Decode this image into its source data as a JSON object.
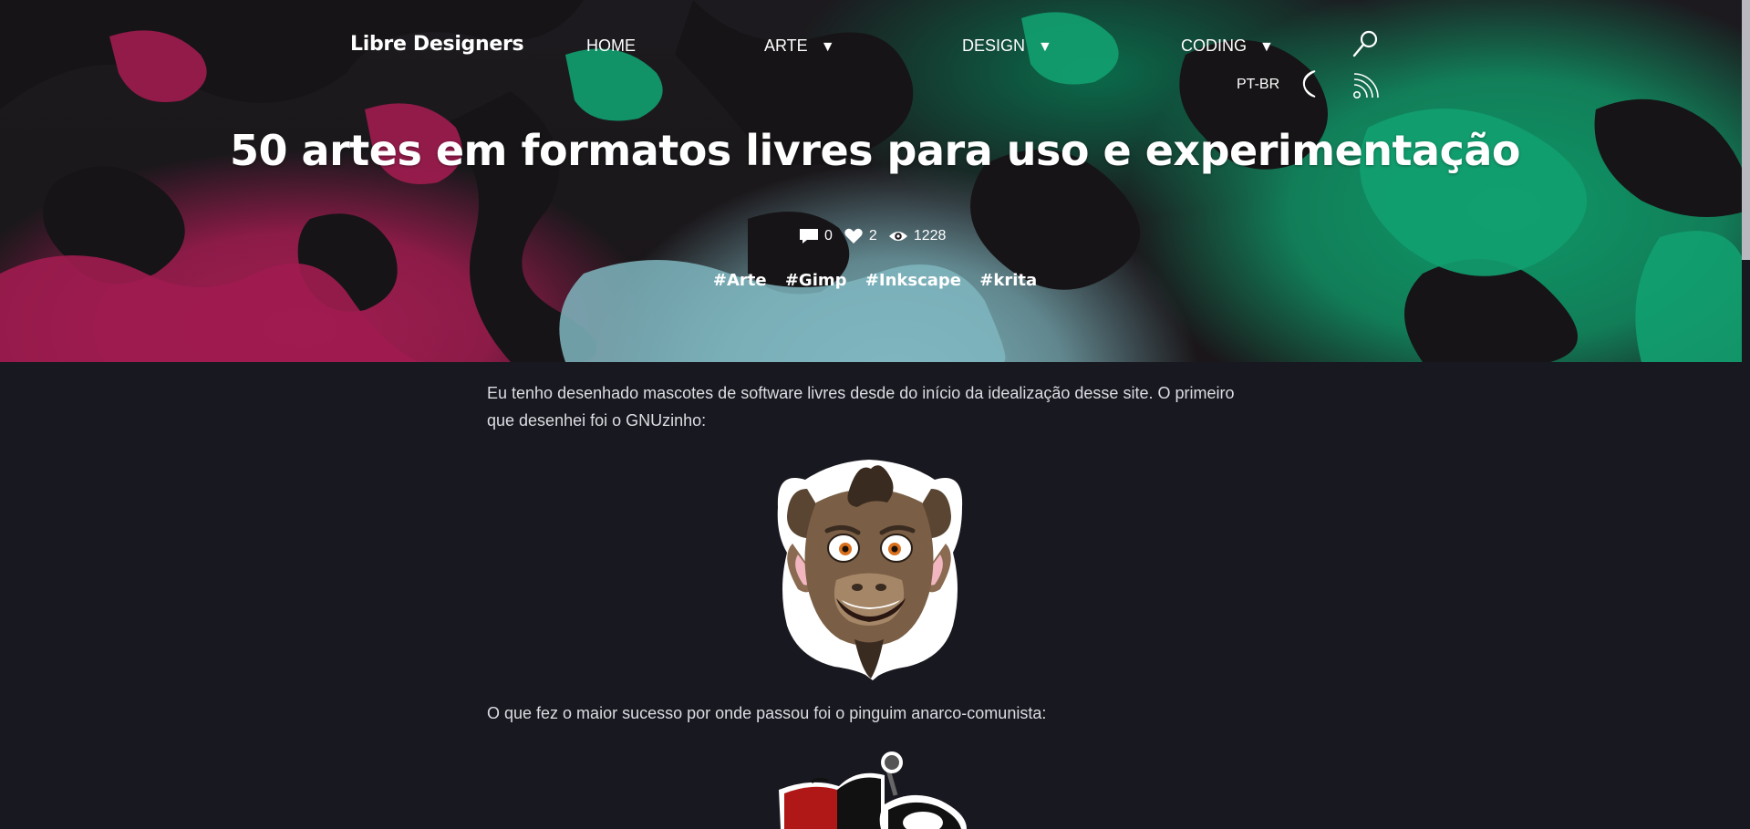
{
  "header": {
    "logo": "Libre Designers",
    "nav": [
      {
        "label": "HOME",
        "has_dropdown": false
      },
      {
        "label": "ARTE",
        "has_dropdown": true
      },
      {
        "label": "DESIGN",
        "has_dropdown": true
      },
      {
        "label": "CODING",
        "has_dropdown": true
      }
    ],
    "caret": "▼",
    "language": "PT-BR",
    "icons": [
      "search-icon",
      "moon-icon",
      "rss-icon"
    ]
  },
  "post": {
    "title": "50 artes em formatos livres para uso e experimentação",
    "comments": "0",
    "likes": "2",
    "views": "1228",
    "tags": [
      "#Arte",
      "#Gimp",
      "#Inkscape",
      "#krita"
    ]
  },
  "article": {
    "paragraph_1": "Eu tenho desenhado mascotes de software livres desde do início da idealização desse site. O primeiro que desenhei foi o GNUzinho:",
    "image_1": "gnu-mascot",
    "paragraph_2": "O que fez o maior sucesso por onde passou foi o pinguim anarco-comunista:",
    "image_2": "anarco-communist-penguin"
  },
  "colors": {
    "background": "#181820",
    "hero_magenta": "#a01c50",
    "hero_green": "#0f9868",
    "hero_teal": "#7fb6bf",
    "text": "#dcdce2"
  }
}
